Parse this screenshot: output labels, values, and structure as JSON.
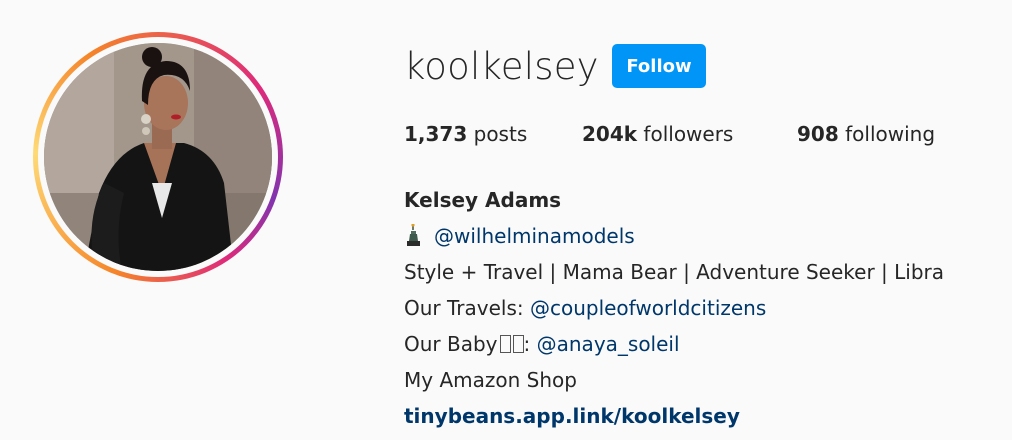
{
  "profile": {
    "username": "koolkelsey",
    "follow_label": "Follow",
    "avatar_icon": "profile-photo"
  },
  "stats": {
    "posts_count": "1,373",
    "posts_label": "posts",
    "followers_count": "204k",
    "followers_label": "followers",
    "following_count": "908",
    "following_label": "following"
  },
  "bio": {
    "full_name": "Kelsey Adams",
    "agency_icon": "statue-of-liberty-icon",
    "agency_handle": "@wilhelminamodels",
    "tagline": "Style + Travel | Mama Bear | Adventure Seeker | Libra",
    "travels_prefix": "Our Travels: ",
    "travels_handle": "@coupleofworldcitizens",
    "baby_prefix": "Our Baby",
    "baby_suffix": ": ",
    "baby_handle": "@anaya_soleil",
    "shop_text": "My Amazon Shop",
    "website": "tinybeans.app.link/koolkelsey"
  },
  "colors": {
    "follow_button": "#0095f6",
    "link": "#00376b",
    "text": "#262626",
    "background": "#fafafa"
  }
}
